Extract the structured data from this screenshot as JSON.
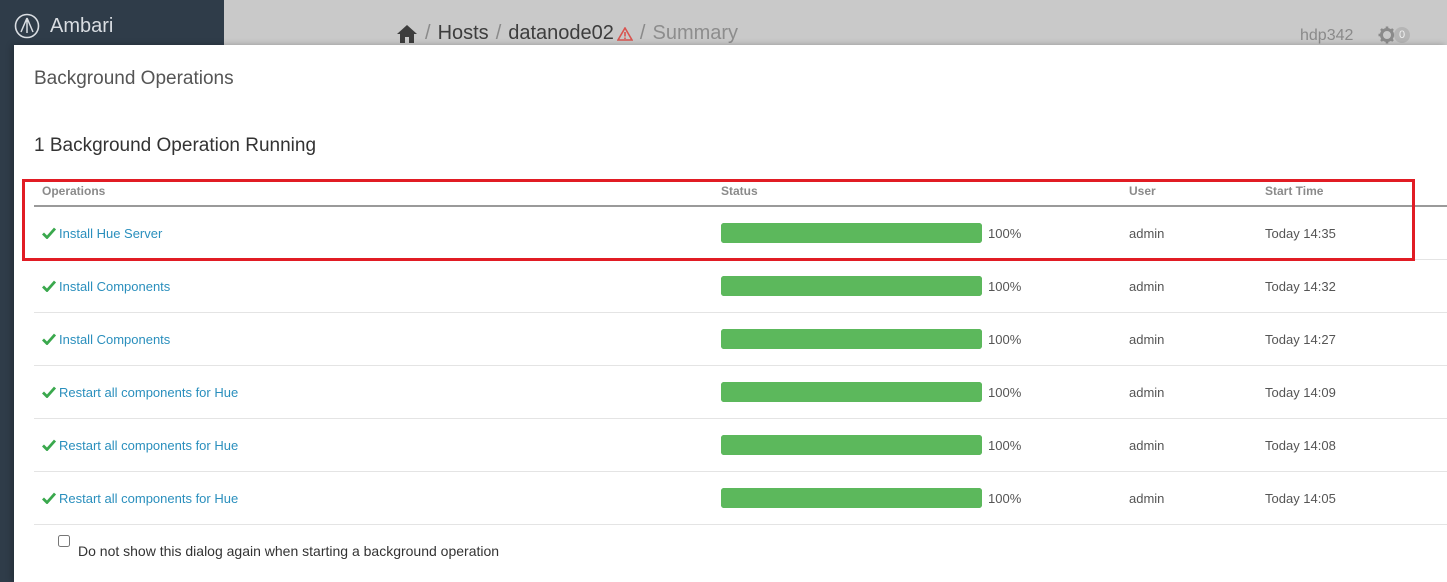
{
  "app": {
    "brand": "Ambari",
    "cluster_name": "hdp342",
    "alert_count": "0"
  },
  "breadcrumb": {
    "hosts": "Hosts",
    "host": "datanode02",
    "page": "Summary",
    "sep": "/"
  },
  "modal": {
    "title": "Background Operations",
    "section_title": "1 Background Operation Running",
    "columns": {
      "operations": "Operations",
      "status": "Status",
      "user": "User",
      "start_time": "Start Time"
    },
    "rows": [
      {
        "name": "Install Hue Server",
        "progress": 100,
        "progress_label": "100%",
        "user": "admin",
        "start": "Today 14:35"
      },
      {
        "name": "Install Components",
        "progress": 100,
        "progress_label": "100%",
        "user": "admin",
        "start": "Today 14:32"
      },
      {
        "name": "Install Components",
        "progress": 100,
        "progress_label": "100%",
        "user": "admin",
        "start": "Today 14:27"
      },
      {
        "name": "Restart all components for Hue",
        "progress": 100,
        "progress_label": "100%",
        "user": "admin",
        "start": "Today 14:09"
      },
      {
        "name": "Restart all components for Hue",
        "progress": 100,
        "progress_label": "100%",
        "user": "admin",
        "start": "Today 14:08"
      },
      {
        "name": "Restart all components for Hue",
        "progress": 100,
        "progress_label": "100%",
        "user": "admin",
        "start": "Today 14:05"
      }
    ],
    "dont_show_label": "Do not show this dialog again when starting a background operation"
  },
  "icons": {
    "home": "home-icon",
    "warning": "warning-icon",
    "gear": "gear-icon",
    "check": "check-icon",
    "logo": "ambari-logo-icon"
  },
  "colors": {
    "link": "#2a8fbd",
    "success": "#5cb85c",
    "highlight": "#e11c24",
    "warning": "#d9534f"
  }
}
